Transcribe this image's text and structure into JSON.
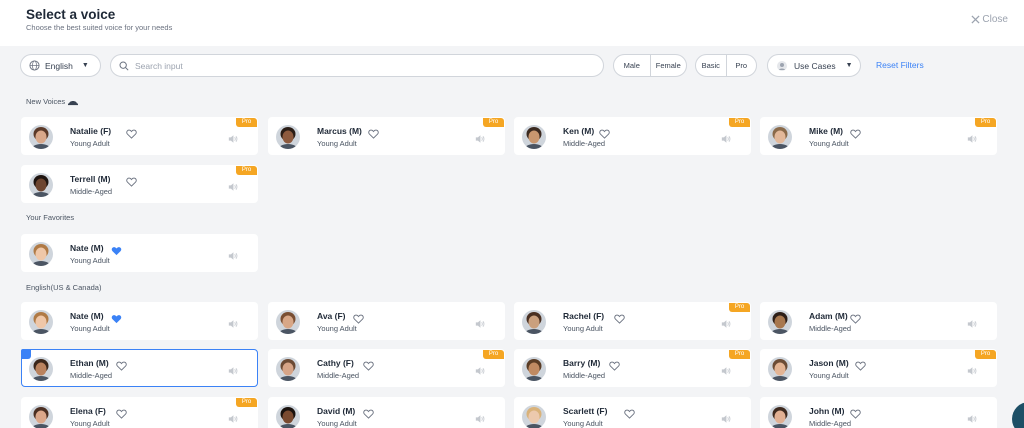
{
  "header": {
    "title": "Select a voice",
    "subtitle": "Choose the best suited voice for your needs",
    "close_label": "Close"
  },
  "filters": {
    "language": "English",
    "search_placeholder": "Search input",
    "gender": [
      "Male",
      "Female"
    ],
    "tier": [
      "Basic",
      "Pro"
    ],
    "use_cases": "Use Cases",
    "reset": "Reset Filters"
  },
  "sections": {
    "new_voices": "New Voices",
    "favorites": "Your Favorites",
    "english": "English(US & Canada)"
  },
  "colors": {
    "accent": "#3b82f6",
    "pro_badge": "#f5a623",
    "favorite_heart": "#3b82f6"
  },
  "voices": [
    {
      "name": "Natalie (F)",
      "age": "Young Adult",
      "pro": "Pro",
      "favorite": false
    },
    {
      "name": "Marcus (M)",
      "age": "Young Adult",
      "pro": "Pro",
      "favorite": false
    },
    {
      "name": "Ken (M)",
      "age": "Middle-Aged",
      "pro": "Pro",
      "favorite": false
    },
    {
      "name": "Mike (M)",
      "age": "Young Adult",
      "pro": "Pro",
      "favorite": false
    },
    {
      "name": "Terrell (M)",
      "age": "Middle-Aged",
      "pro": "Pro",
      "favorite": false
    },
    {
      "name": "Nate (M)",
      "age": "Young Adult",
      "pro": "",
      "favorite": true
    },
    {
      "name": "Nate (M)",
      "age": "Young Adult",
      "pro": "",
      "favorite": true
    },
    {
      "name": "Ava (F)",
      "age": "Young Adult",
      "pro": "",
      "favorite": false
    },
    {
      "name": "Rachel (F)",
      "age": "Young Adult",
      "pro": "Pro",
      "favorite": false
    },
    {
      "name": "Adam (M)",
      "age": "Middle-Aged",
      "pro": "",
      "favorite": false
    },
    {
      "name": "Ethan (M)",
      "age": "Middle-Aged",
      "pro": "",
      "favorite": false,
      "selected": true
    },
    {
      "name": "Cathy (F)",
      "age": "Middle-Aged",
      "pro": "Pro",
      "favorite": false
    },
    {
      "name": "Barry (M)",
      "age": "Middle-Aged",
      "pro": "Pro",
      "favorite": false
    },
    {
      "name": "Jason (M)",
      "age": "Young Adult",
      "pro": "Pro",
      "favorite": false
    },
    {
      "name": "Elena (F)",
      "age": "Young Adult",
      "pro": "Pro",
      "favorite": false
    },
    {
      "name": "David (M)",
      "age": "Young Adult",
      "pro": "",
      "favorite": false
    },
    {
      "name": "Scarlett (F)",
      "age": "Young Adult",
      "pro": "",
      "favorite": false
    },
    {
      "name": "John (M)",
      "age": "Middle-Aged",
      "pro": "",
      "favorite": false
    }
  ]
}
